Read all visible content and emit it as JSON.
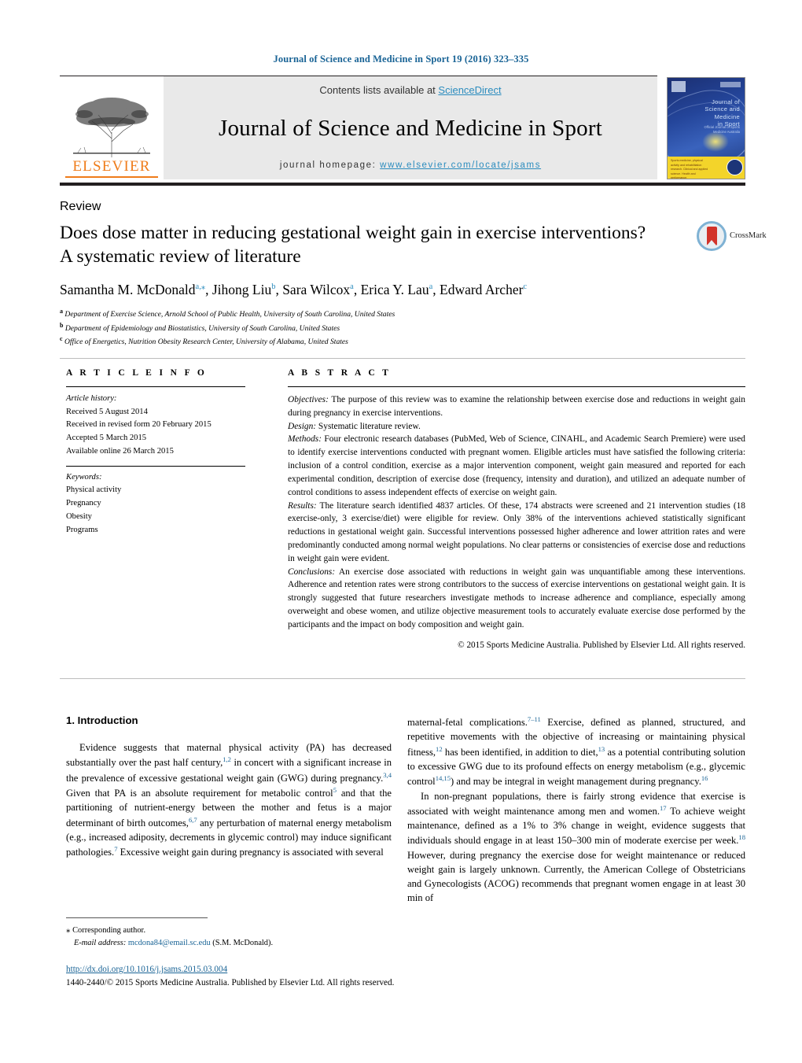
{
  "running_head": "Journal of Science and Medicine in Sport 19 (2016) 323–335",
  "masthead": {
    "publisher_name": "ELSEVIER",
    "contents_prefix": "Contents lists available at ",
    "contents_link": "ScienceDirect",
    "journal_title": "Journal of Science and Medicine in Sport",
    "homepage_prefix": "journal homepage: ",
    "homepage_url": "www.elsevier.com/locate/jsams",
    "cover": {
      "title": "Journal of\nScience and Medicine\nin Sport",
      "subtitle": "Official Journal of Sports Medicine Australia",
      "yellow_note": "Sports medicine, physical activity and rehabilitation research. Clinical and applied science. Health and performance."
    }
  },
  "article": {
    "type": "Review",
    "title": "Does dose matter in reducing gestational weight gain in exercise interventions? A systematic review of literature",
    "crossmark_label": "CrossMark",
    "authors_html": "Samantha M. McDonald<sup>a,⁎</sup>, Jihong Liu<sup>b</sup>, Sara Wilcox<sup>a</sup>, Erica Y. Lau<sup>a</sup>, Edward Archer<sup>c</sup>",
    "affiliations": [
      {
        "marker": "a",
        "text": "Department of Exercise Science, Arnold School of Public Health, University of South Carolina, United States"
      },
      {
        "marker": "b",
        "text": "Department of Epidemiology and Biostatistics, University of South Carolina, United States"
      },
      {
        "marker": "c",
        "text": "Office of Energetics, Nutrition Obesity Research Center, University of Alabama, United States"
      }
    ]
  },
  "article_info": {
    "section_label": "A R T I C L E   I N F O",
    "history_label": "Article history:",
    "history": [
      "Received 5 August 2014",
      "Received in revised form 20 February 2015",
      "Accepted 5 March 2015",
      "Available online 26 March 2015"
    ],
    "keywords_label": "Keywords:",
    "keywords": [
      "Physical activity",
      "Pregnancy",
      "Obesity",
      "Programs"
    ]
  },
  "abstract": {
    "section_label": "A B S T R A C T",
    "objectives_label": "Objectives:",
    "objectives_text": " The purpose of this review was to examine the relationship between exercise dose and reductions in weight gain during pregnancy in exercise interventions.",
    "design_label": "Design:",
    "design_text": " Systematic literature review.",
    "methods_label": "Methods:",
    "methods_text": " Four electronic research databases (PubMed, Web of Science, CINAHL, and Academic Search Premiere) were used to identify exercise interventions conducted with pregnant women. Eligible articles must have satisfied the following criteria: inclusion of a control condition, exercise as a major intervention component, weight gain measured and reported for each experimental condition, description of exercise dose (frequency, intensity and duration), and utilized an adequate number of control conditions to assess independent effects of exercise on weight gain.",
    "results_label": "Results:",
    "results_text": " The literature search identified 4837 articles. Of these, 174 abstracts were screened and 21 intervention studies (18 exercise-only, 3 exercise/diet) were eligible for review. Only 38% of the interventions achieved statistically significant reductions in gestational weight gain. Successful interventions possessed higher adherence and lower attrition rates and were predominantly conducted among normal weight populations. No clear patterns or consistencies of exercise dose and reductions in weight gain were evident.",
    "conclusions_label": "Conclusions:",
    "conclusions_text": " An exercise dose associated with reductions in weight gain was unquantifiable among these interventions. Adherence and retention rates were strong contributors to the success of exercise interventions on gestational weight gain. It is strongly suggested that future researchers investigate methods to increase adherence and compliance, especially among overweight and obese women, and utilize objective measurement tools to accurately evaluate exercise dose performed by the participants and the impact on body composition and weight gain.",
    "copyright": "© 2015 Sports Medicine Australia. Published by Elsevier Ltd. All rights reserved."
  },
  "introduction": {
    "heading": "1.  Introduction",
    "left_paragraph_html": "Evidence suggests that maternal physical activity (PA) has decreased substantially over the past half century,<sup class=\"ref\">1,2</sup> in concert with a significant increase in the prevalence of excessive gestational weight gain (GWG) during pregnancy.<sup class=\"ref\">3,4</sup> Given that PA is an absolute requirement for metabolic control<sup class=\"ref\">5</sup> and that the partitioning of nutrient-energy between the mother and fetus is a major determinant of birth outcomes,<sup class=\"ref\">6,7</sup> any perturbation of maternal energy metabolism (e.g., increased adiposity, decrements in glycemic control) may induce significant pathologies.<sup class=\"ref\">7</sup> Excessive weight gain during pregnancy is associated with several",
    "right_paragraph1_html": "maternal-fetal complications.<sup class=\"ref\">7–11</sup> Exercise, defined as planned, structured, and repetitive movements with the objective of increasing or maintaining physical fitness,<sup class=\"ref\">12</sup> has been identified, in addition to diet,<sup class=\"ref\">13</sup> as a potential contributing solution to excessive GWG due to its profound effects on energy metabolism (e.g., glycemic control<sup class=\"ref\">14,15</sup>) and may be integral in weight management during pregnancy.<sup class=\"ref\">16</sup>",
    "right_paragraph2_html": "In non-pregnant populations, there is fairly strong evidence that exercise is associated with weight maintenance among men and women.<sup class=\"ref\">17</sup> To achieve weight maintenance, defined as a 1% to 3% change in weight, evidence suggests that individuals should engage in at least 150–300 min of moderate exercise per week.<sup class=\"ref\">18</sup> However, during pregnancy the exercise dose for weight maintenance or reduced weight gain is largely unknown. Currently, the American College of Obstetricians and Gynecologists (ACOG) recommends that pregnant women engage in at least 30 min of"
  },
  "footnote": {
    "corresponding_marker": "⁎",
    "corresponding_text": "Corresponding author.",
    "email_label": "E-mail address:",
    "email": "mcdona84@email.sc.edu",
    "email_suffix": "(S.M. McDonald)."
  },
  "page_footer": {
    "doi": "http://dx.doi.org/10.1016/j.jsams.2015.03.004",
    "issn_line": "1440-2440/© 2015 Sports Medicine Australia. Published by Elsevier Ltd. All rights reserved."
  },
  "colors": {
    "link_blue": "#1a6496",
    "science_direct_blue": "#2b8cbe",
    "elsevier_orange": "#ef7c1a",
    "band_grey": "#e9e9e9"
  }
}
